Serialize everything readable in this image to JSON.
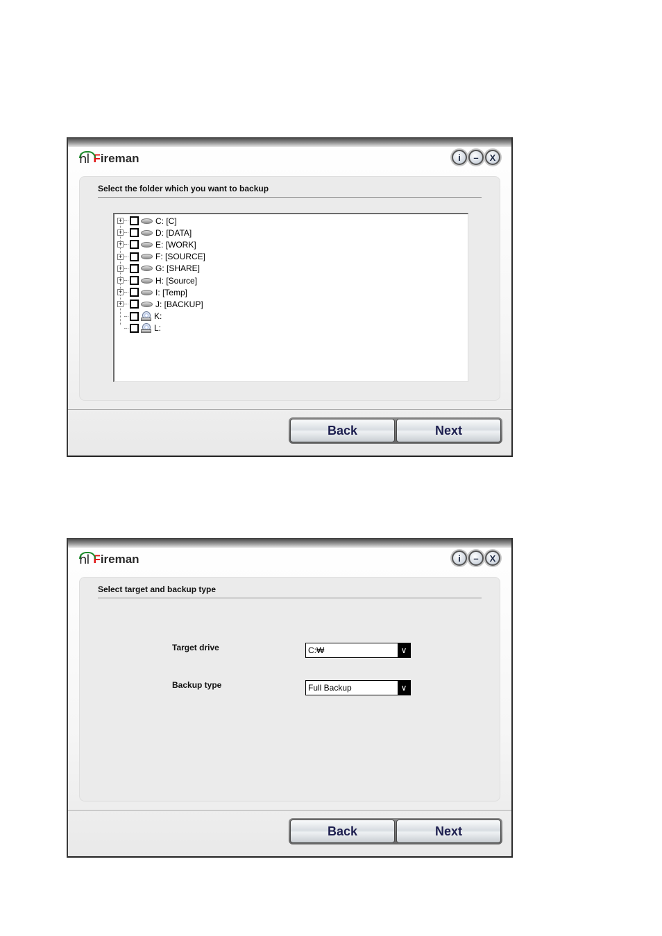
{
  "window1": {
    "app_title_prefix": "F",
    "app_title_rest": "ireman",
    "logo_mark": "hl",
    "controls": {
      "info": "i",
      "minimize": "–",
      "close": "X"
    },
    "heading": "Select the folder which you want to backup",
    "tree": [
      {
        "label": "C: [C]",
        "type": "drive",
        "expandable": true,
        "checked": false
      },
      {
        "label": "D: [DATA]",
        "type": "drive",
        "expandable": true,
        "checked": false
      },
      {
        "label": "E: [WORK]",
        "type": "drive",
        "expandable": true,
        "checked": false
      },
      {
        "label": "F: [SOURCE]",
        "type": "drive",
        "expandable": true,
        "checked": false
      },
      {
        "label": "G: [SHARE]",
        "type": "drive",
        "expandable": true,
        "checked": false
      },
      {
        "label": "H: [Source]",
        "type": "drive",
        "expandable": true,
        "checked": false
      },
      {
        "label": "I: [Temp]",
        "type": "drive",
        "expandable": true,
        "checked": false
      },
      {
        "label": "J: [BACKUP]",
        "type": "drive",
        "expandable": true,
        "checked": false
      },
      {
        "label": "K:",
        "type": "cdrom",
        "expandable": false,
        "checked": false
      },
      {
        "label": "L:",
        "type": "cdrom",
        "expandable": false,
        "checked": false
      }
    ],
    "back_label": "Back",
    "next_label": "Next"
  },
  "window2": {
    "app_title_prefix": "F",
    "app_title_rest": "ireman",
    "logo_mark": "hl",
    "controls": {
      "info": "i",
      "minimize": "–",
      "close": "X"
    },
    "heading": "Select target and backup type",
    "target_drive_label": "Target drive",
    "target_drive_value": "C:₩",
    "backup_type_label": "Backup type",
    "backup_type_value": "Full Backup",
    "back_label": "Back",
    "next_label": "Next"
  },
  "colors": {
    "brand_red": "#e01010",
    "logo_green": "#1c8a2a",
    "button_text": "#1d1f4f"
  }
}
